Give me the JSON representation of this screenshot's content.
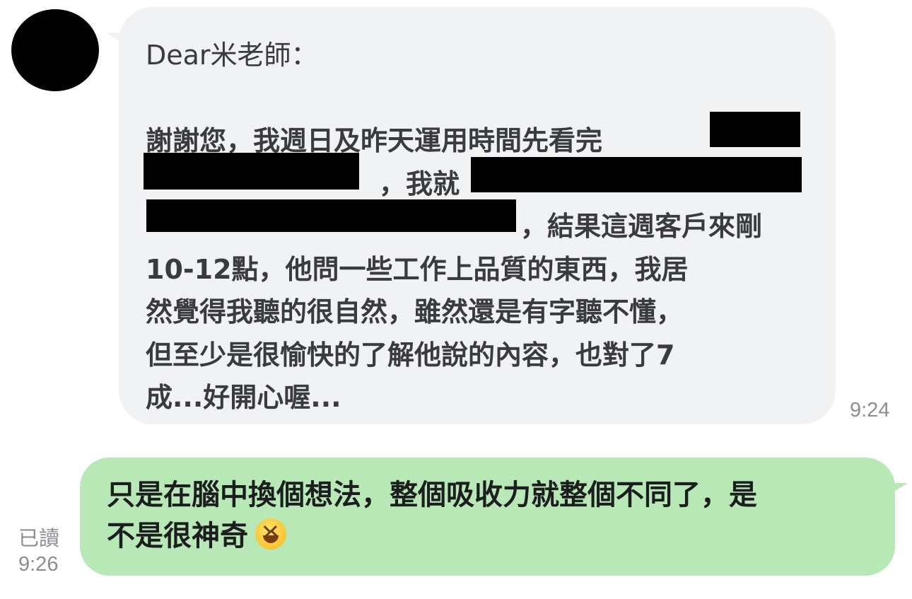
{
  "incoming_message": {
    "lines": [
      "Dear米老師：",
      "",
      "謝謝您，我週日及昨天運用時間先看完",
      "，我就",
      "，結果這週客戶來剛",
      "10-12點，他問一些工作上品質的東西，我居",
      "然覺得我聽的很自然，雖然還是有字聽不懂，",
      "但至少是很愉快的了解他說的內容，也對了7",
      "成...好開心喔..."
    ],
    "time": "9:24"
  },
  "outgoing_message": {
    "lines": [
      "只是在腦中換個想法，整個吸收力就整個不同了，是",
      "不是很神奇"
    ],
    "emoji": "grinning-squinting-face-emoji",
    "read_label": "已讀",
    "time": "9:26"
  },
  "colors": {
    "incoming_bubble": "#f1f2f4",
    "outgoing_bubble": "#b7e8b6",
    "avatar": "#000000",
    "redaction": "#000000",
    "timestamp": "#8b8e93"
  }
}
